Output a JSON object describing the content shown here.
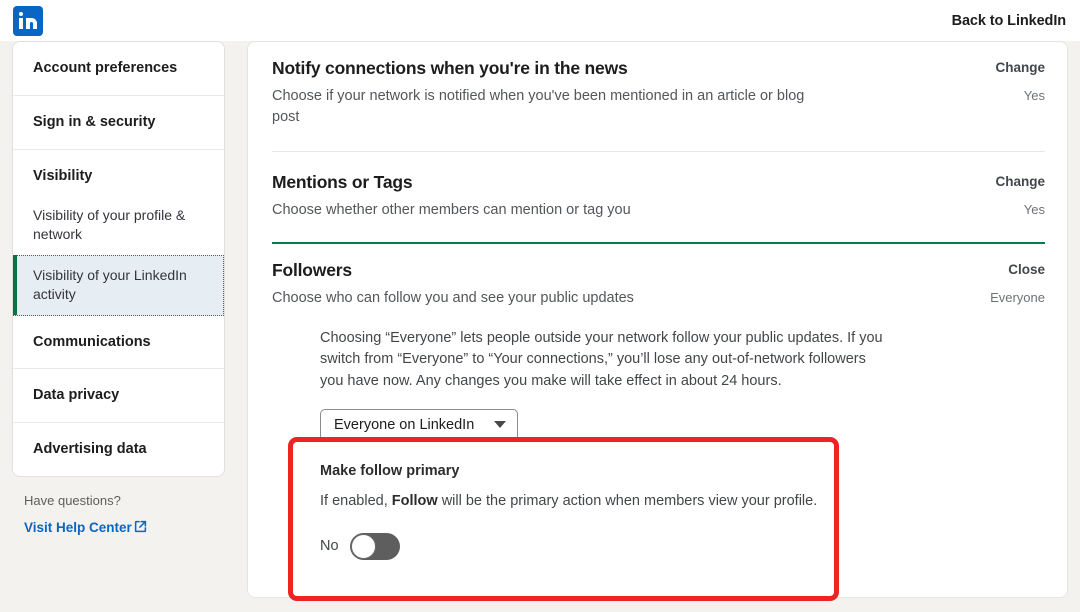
{
  "header": {
    "logo_icon": "linkedin-logo-icon",
    "back_label": "Back to LinkedIn"
  },
  "sidebar": {
    "items": [
      {
        "label": "Account preferences",
        "type": "heading",
        "active": false
      },
      {
        "label": "Sign in & security",
        "type": "heading",
        "active": false
      },
      {
        "label": "Visibility",
        "type": "group-head",
        "active": false
      },
      {
        "label": "Visibility of your profile & network",
        "type": "sub",
        "active": false
      },
      {
        "label": "Visibility of your LinkedIn activity",
        "type": "sub",
        "active": true
      },
      {
        "label": "Communications",
        "type": "heading",
        "active": false
      },
      {
        "label": "Data privacy",
        "type": "heading",
        "active": false
      },
      {
        "label": "Advertising data",
        "type": "heading",
        "active": false
      }
    ],
    "footer": {
      "question": "Have questions?",
      "help_link": "Visit Help Center",
      "help_icon": "external-link-icon"
    }
  },
  "main": {
    "sections": [
      {
        "title": "Notify connections when you're in the news",
        "description": "Choose if your network is notified when you've been mentioned in an article or blog post",
        "action": "Change",
        "value": "Yes"
      },
      {
        "title": "Mentions or Tags",
        "description": "Choose whether other members can mention or tag you",
        "action": "Change",
        "value": "Yes"
      },
      {
        "title": "Followers",
        "description": "Choose who can follow you and see your public updates",
        "action": "Close",
        "value": "Everyone"
      }
    ],
    "followers_expanded": {
      "body": "Choosing “Everyone” lets people outside your network follow your public updates. If you switch from “Everyone” to “Your connections,” you’ll lose any out-of-network followers you have now. Any changes you make will take effect in about 24 hours.",
      "select_value": "Everyone on LinkedIn",
      "select_caret_icon": "chevron-down-icon",
      "make_primary": {
        "title": "Make follow primary",
        "desc_before": "If enabled, ",
        "desc_bold": "Follow",
        "desc_after": " will be the primary action when members view your profile.",
        "toggle_label": "No",
        "toggle_state": "off"
      }
    }
  },
  "colors": {
    "brand_blue": "#0A66C2",
    "green_accent": "#057642",
    "highlight_red": "#EE2424",
    "page_bg": "#F4F2EE"
  }
}
